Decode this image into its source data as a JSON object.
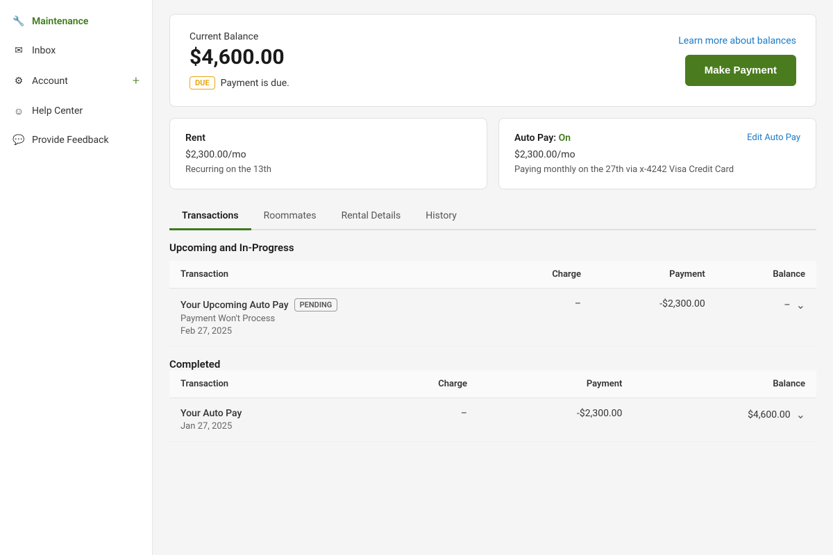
{
  "sidebar": {
    "active_item": "Maintenance",
    "items": [
      {
        "id": "maintenance",
        "label": "Maintenance",
        "icon": "tool-icon",
        "active": true
      },
      {
        "id": "inbox",
        "label": "Inbox",
        "icon": "inbox-icon",
        "active": false
      },
      {
        "id": "account",
        "label": "Account",
        "icon": "gear-icon",
        "active": false,
        "has_plus": true
      },
      {
        "id": "help-center",
        "label": "Help Center",
        "icon": "help-icon",
        "active": false
      },
      {
        "id": "provide-feedback",
        "label": "Provide Feedback",
        "icon": "feedback-icon",
        "active": false
      }
    ]
  },
  "balance_card": {
    "label": "Current Balance",
    "amount": "$4,600.00",
    "due_badge": "DUE",
    "due_text": "Payment is due.",
    "learn_more": "Learn more about balances",
    "make_payment": "Make Payment"
  },
  "rent_card": {
    "title": "Rent",
    "amount": "$2,300.00/mo",
    "recurring": "Recurring on the 13th"
  },
  "autopay_card": {
    "title_prefix": "Auto Pay:",
    "status": "On",
    "edit_label": "Edit Auto Pay",
    "amount": "$2,300.00/mo",
    "description": "Paying monthly on the 27th via x-4242 Visa Credit Card"
  },
  "tabs": [
    {
      "id": "transactions",
      "label": "Transactions",
      "active": true
    },
    {
      "id": "roommates",
      "label": "Roommates",
      "active": false
    },
    {
      "id": "rental-details",
      "label": "Rental Details",
      "active": false
    },
    {
      "id": "history",
      "label": "History",
      "active": false
    }
  ],
  "upcoming_section": {
    "heading": "Upcoming and In-Progress",
    "table_headers": [
      "Transaction",
      "Charge",
      "Payment",
      "Balance"
    ],
    "rows": [
      {
        "name": "Your Upcoming Auto Pay",
        "badge": "PENDING",
        "sub1": "Payment Won't Process",
        "sub2": "Feb 27, 2025",
        "charge": "–",
        "payment": "-$2,300.00",
        "balance": "–"
      }
    ]
  },
  "completed_section": {
    "heading": "Completed",
    "table_headers": [
      "Transaction",
      "Charge",
      "Payment",
      "Balance"
    ],
    "rows": [
      {
        "name": "Your Auto Pay",
        "sub1": "Jan 27, 2025",
        "charge": "–",
        "payment": "-$2,300.00",
        "balance": "$4,600.00"
      }
    ]
  }
}
